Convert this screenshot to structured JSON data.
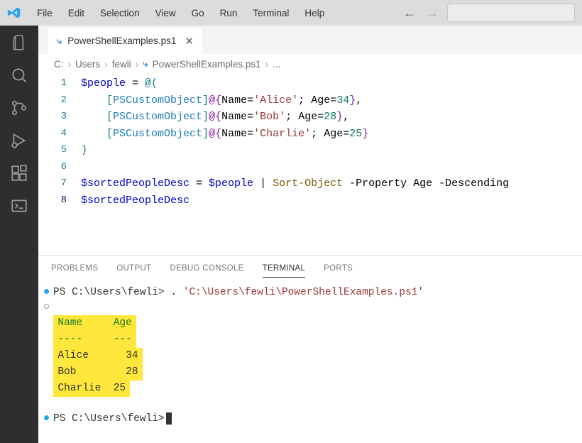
{
  "menubar": [
    "File",
    "Edit",
    "Selection",
    "View",
    "Go",
    "Run",
    "Terminal",
    "Help"
  ],
  "tab": {
    "filename": "PowerShellExamples.ps1"
  },
  "breadcrumb": {
    "c": "C:",
    "users": "Users",
    "user": "fewli",
    "file": "PowerShellExamples.ps1",
    "more": "..."
  },
  "code": {
    "l1": {
      "var": "$people",
      "eq": " = ",
      "arr": "@("
    },
    "lobj": {
      "type": "PSCustomObject",
      "name_key": "Name",
      "age_key": "Age"
    },
    "people": [
      {
        "name": "Alice",
        "age": "34"
      },
      {
        "name": "Bob",
        "age": "28"
      },
      {
        "name": "Charlie",
        "age": "25"
      }
    ],
    "close": ")",
    "l7": {
      "var": "$sortedPeopleDesc",
      "eq": " = ",
      "src": "$people",
      "pipe": " | ",
      "cmd": "Sort-Object",
      "p1": " -Property ",
      "prop": "Age",
      "p2": " -Descending"
    },
    "l8": {
      "var": "$sortedPeopleDesc"
    }
  },
  "panel": {
    "tabs": [
      "PROBLEMS",
      "OUTPUT",
      "DEBUG CONSOLE",
      "TERMINAL",
      "PORTS"
    ],
    "activeIndex": 3
  },
  "terminal": {
    "prompt": "PS C:\\Users\\fewli>",
    "cmd_dot": ". ",
    "cmd_path": "'C:\\Users\\fewli\\PowerShellExamples.ps1'",
    "hdr_name": "Name",
    "hdr_age": "Age",
    "sep_name": "----",
    "sep_age": "---",
    "rows": [
      {
        "name": "Alice",
        "age": "34",
        "pad": "  "
      },
      {
        "name": "Bob",
        "age": "28",
        "pad": "    "
      },
      {
        "name": "Charlie",
        "age": "25",
        "pad": ""
      }
    ]
  }
}
